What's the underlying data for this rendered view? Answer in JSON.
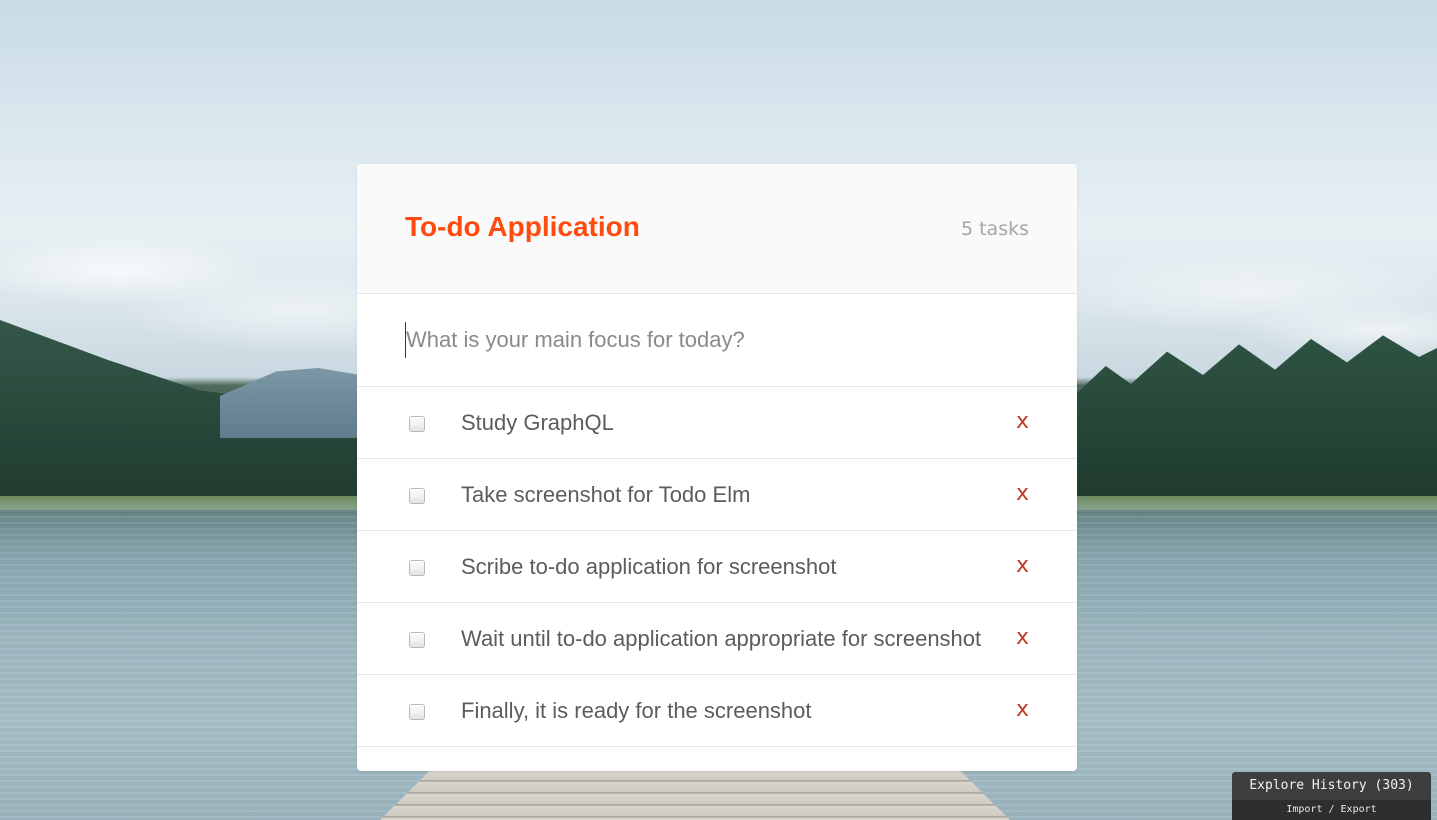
{
  "app": {
    "title": "To-do Application",
    "task_count": "5 tasks",
    "accent_color": "#ff4b0f"
  },
  "new_task": {
    "value": "",
    "placeholder": "What is your main focus for today?"
  },
  "tasks": [
    {
      "label": "Study GraphQL",
      "checked": false,
      "delete_label": "x"
    },
    {
      "label": "Take screenshot for Todo Elm",
      "checked": false,
      "delete_label": "x"
    },
    {
      "label": "Scribe to-do application for screenshot",
      "checked": false,
      "delete_label": "x"
    },
    {
      "label": "Wait until to-do application appropriate for screenshot",
      "checked": false,
      "delete_label": "x"
    },
    {
      "label": "Finally, it is ready for the screenshot",
      "checked": false,
      "delete_label": "x"
    }
  ],
  "history": {
    "title": "Explore History (303)",
    "actions": "Import / Export"
  }
}
